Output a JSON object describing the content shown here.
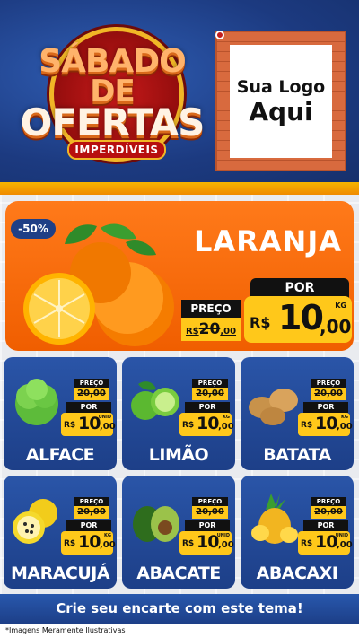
{
  "header": {
    "title_line1": "SÁBADO",
    "title_line2": "DE",
    "title_line3": "OFERTAS",
    "subtitle": "IMPERDÍVEIS",
    "logo_line1": "Sua Logo",
    "logo_line2": "Aqui"
  },
  "featured": {
    "discount": "-50%",
    "name": "LARANJA",
    "old_label": "PREÇO",
    "old_price_int": "20",
    "old_price_dec": ",00",
    "old_prefix": "R$",
    "new_label": "POR",
    "currency": "R$",
    "price_int": "10",
    "price_dec": ",00",
    "unit": "KG"
  },
  "products": [
    {
      "name": "ALFACE",
      "old_label": "PREÇO",
      "old_price": "20,00",
      "new_label": "POR",
      "currency": "R$",
      "price_int": "10",
      "price_dec": ",00",
      "unit": "UNID"
    },
    {
      "name": "LIMÃO",
      "old_label": "PREÇO",
      "old_price": "20,00",
      "new_label": "POR",
      "currency": "R$",
      "price_int": "10",
      "price_dec": ",00",
      "unit": "KG"
    },
    {
      "name": "BATATA",
      "old_label": "PREÇO",
      "old_price": "20,00",
      "new_label": "POR",
      "currency": "R$",
      "price_int": "10",
      "price_dec": ",00",
      "unit": "KG"
    },
    {
      "name": "MARACUJÁ",
      "old_label": "PREÇO",
      "old_price": "20,00",
      "new_label": "POR",
      "currency": "R$",
      "price_int": "10",
      "price_dec": ",00",
      "unit": "KG"
    },
    {
      "name": "ABACATE",
      "old_label": "PREÇO",
      "old_price": "20,00",
      "new_label": "POR",
      "currency": "R$",
      "price_int": "10",
      "price_dec": ",00",
      "unit": "UNID"
    },
    {
      "name": "ABACAXI",
      "old_label": "PREÇO",
      "old_price": "20,00",
      "new_label": "POR",
      "currency": "R$",
      "price_int": "10",
      "price_dec": ",00",
      "unit": "UNID"
    }
  ],
  "footer": {
    "cta": "Crie seu encarte com este tema!",
    "disclaimer": "*Imagens Meramente Ilustrativas"
  },
  "colors": {
    "navy": "#1f3f86",
    "orange": "#f05e00",
    "yellow": "#ffc81a",
    "red": "#b70f0f"
  }
}
